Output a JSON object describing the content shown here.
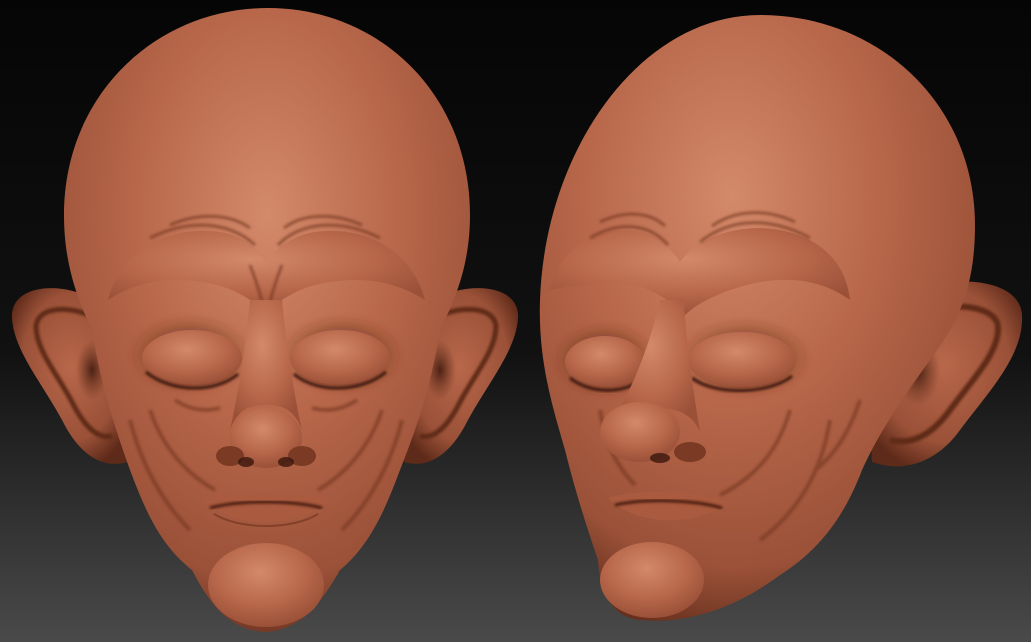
{
  "scene": {
    "background_top": "#050505",
    "background_mid": "#111111",
    "background_bottom": "#4a4a4a",
    "clay_highlight": "#d38a6a",
    "clay_base": "#b8674a",
    "clay_mid": "#9a5138",
    "clay_shadow": "#5e2a19",
    "clay_deep": "#3a170c"
  },
  "subjects": [
    {
      "view": "front"
    },
    {
      "view": "three-quarter"
    }
  ]
}
